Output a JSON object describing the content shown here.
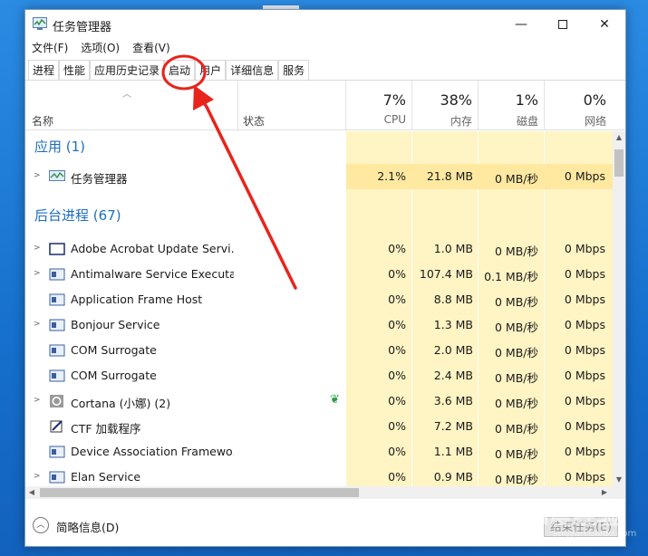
{
  "window": {
    "title": "任务管理器",
    "minimize_glyph": "—",
    "close_glyph": "✕"
  },
  "menu": [
    "文件(F)",
    "选项(O)",
    "查看(V)"
  ],
  "tabs": [
    "进程",
    "性能",
    "应用历史记录",
    "启动",
    "用户",
    "详细信息",
    "服务"
  ],
  "active_tab": "进程",
  "header": {
    "name": "名称",
    "status": "状态",
    "cpu": {
      "pct": "7%",
      "label": "CPU"
    },
    "memory": {
      "pct": "38%",
      "label": "内存"
    },
    "disk": {
      "pct": "1%",
      "label": "磁盘"
    },
    "network": {
      "pct": "0%",
      "label": "网络"
    }
  },
  "groups": {
    "apps": "应用 (1)",
    "background": "后台进程 (67)"
  },
  "processes": [
    {
      "name": "任务管理器",
      "cpu": "2.1%",
      "mem": "21.8 MB",
      "disk": "0 MB/秒",
      "net": "0 Mbps",
      "icon": "taskmgr-icon",
      "expandable": true
    },
    {
      "name": "Adobe Acrobat Update Servi...",
      "cpu": "0%",
      "mem": "1.0 MB",
      "disk": "0 MB/秒",
      "net": "0 Mbps",
      "icon": "window-icon",
      "expandable": true
    },
    {
      "name": "Antimalware Service Executa...",
      "cpu": "0%",
      "mem": "107.4 MB",
      "disk": "0.1 MB/秒",
      "net": "0 Mbps",
      "icon": "service-icon",
      "expandable": true
    },
    {
      "name": "Application Frame Host",
      "cpu": "0%",
      "mem": "8.8 MB",
      "disk": "0 MB/秒",
      "net": "0 Mbps",
      "icon": "service-icon",
      "expandable": false
    },
    {
      "name": "Bonjour Service",
      "cpu": "0%",
      "mem": "1.3 MB",
      "disk": "0 MB/秒",
      "net": "0 Mbps",
      "icon": "service-icon",
      "expandable": true
    },
    {
      "name": "COM Surrogate",
      "cpu": "0%",
      "mem": "2.0 MB",
      "disk": "0 MB/秒",
      "net": "0 Mbps",
      "icon": "service-icon",
      "expandable": false
    },
    {
      "name": "COM Surrogate",
      "cpu": "0%",
      "mem": "2.4 MB",
      "disk": "0 MB/秒",
      "net": "0 Mbps",
      "icon": "service-icon",
      "expandable": false
    },
    {
      "name": "Cortana (小娜) (2)",
      "cpu": "0%",
      "mem": "3.6 MB",
      "disk": "0 MB/秒",
      "net": "0 Mbps",
      "icon": "cortana-icon",
      "expandable": true
    },
    {
      "name": "CTF 加载程序",
      "cpu": "0%",
      "mem": "7.2 MB",
      "disk": "0 MB/秒",
      "net": "0 Mbps",
      "icon": "ctf-icon",
      "expandable": false
    },
    {
      "name": "Device Association Framewo...",
      "cpu": "0%",
      "mem": "1.1 MB",
      "disk": "0 MB/秒",
      "net": "0 Mbps",
      "icon": "service-icon",
      "expandable": false
    },
    {
      "name": "Elan Service",
      "cpu": "0%",
      "mem": "0.9 MB",
      "disk": "0 MB/秒",
      "net": "0 Mbps",
      "icon": "service-icon",
      "expandable": true
    }
  ],
  "footer": {
    "fewer_details": "简略信息(D)",
    "end_task": "结束任务(E)"
  },
  "colors": {
    "accent": "#1f6fbf",
    "heat_light": "#fff4c4",
    "heat_medium": "#ffeaa8",
    "annotation": "#e8241c"
  },
  "watermark": {
    "text": "Bai度经验",
    "sub": "jingyan.baidu.com"
  }
}
